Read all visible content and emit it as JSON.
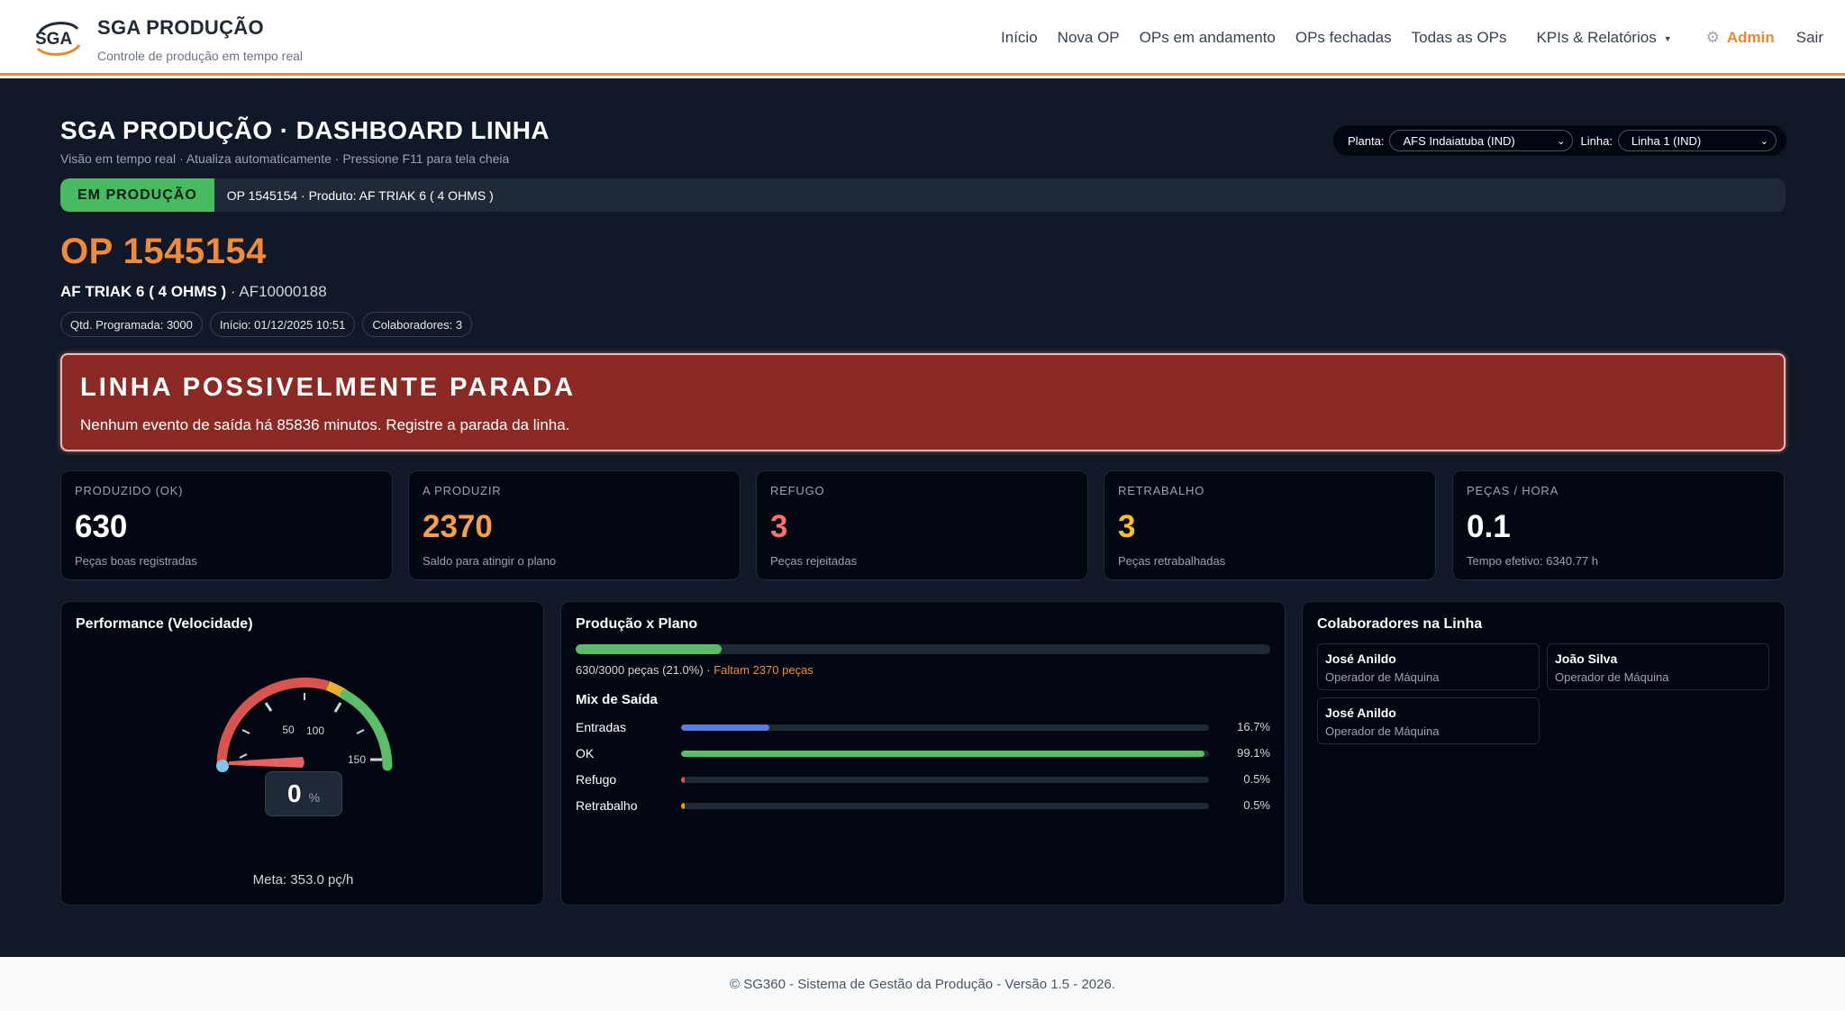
{
  "brand": {
    "logo_text": "SGA",
    "title": "SGA PRODUÇÃO",
    "subtitle": "Controle de produção em tempo real"
  },
  "nav": {
    "links": [
      "Início",
      "Nova OP",
      "OPs em andamento",
      "OPs fechadas",
      "Todas as OPs"
    ],
    "dropdown_label": "KPIs & Relatórios",
    "user_label": "Admin",
    "logout_label": "Sair"
  },
  "dashboard": {
    "title": "SGA PRODUÇÃO · DASHBOARD LINHA",
    "subtitle": "Visão em tempo real · Atualiza automaticamente · Pressione F11 para tela cheia",
    "planta_label": "Planta:",
    "planta_value": "AFS Indaiatuba (IND)",
    "linha_label": "Linha:",
    "linha_value": "Linha 1 (IND)"
  },
  "status": {
    "badge": "EM PRODUÇÃO",
    "text": "OP 1545154 · Produto: AF TRIAK 6 ( 4 OHMS )",
    "badge_color": "#48bb62"
  },
  "op": {
    "title": "OP 1545154",
    "product": "AF TRIAK 6 ( 4 OHMS )",
    "code": "· AF10000188",
    "pills": [
      "Qtd. Programada: 3000",
      "Início: 01/12/2025 10:51",
      "Colaboradores: 3"
    ]
  },
  "alert": {
    "title": "LINHA POSSIVELMENTE PARADA",
    "message": "Nenhum evento de saída há 85836 minutos. Registre a parada da linha.",
    "color": "#8b2a25"
  },
  "kpis": [
    {
      "label": "PRODUZIDO (OK)",
      "value": "630",
      "sub": "Peças boas registradas",
      "color": "#ffffff"
    },
    {
      "label": "A PRODUZIR",
      "value": "2370",
      "sub": "Saldo para atingir o plano",
      "color": "#f6a04d"
    },
    {
      "label": "REFUGO",
      "value": "3",
      "sub": "Peças rejeitadas",
      "color": "#f87171"
    },
    {
      "label": "RETRABALHO",
      "value": "3",
      "sub": "Peças retrabalhadas",
      "color": "#fbbf24"
    },
    {
      "label": "PEÇAS / HORA",
      "value": "0.1",
      "sub": "Tempo efetivo: 6340.77 h",
      "color": "#ffffff"
    }
  ],
  "performance": {
    "title": "Performance (Velocidade)",
    "value": "0",
    "unit": "%",
    "percent": 0,
    "tick_labels": [
      "50",
      "100",
      "150"
    ],
    "meta": "Meta: 353.0 pç/h"
  },
  "producao": {
    "title": "Produção x Plano",
    "progress_fraction": 0.21,
    "progress_text": "630/3000 peças (21.0%) ·",
    "faltam_text": "Faltam 2370 peças",
    "mix_title": "Mix de Saída",
    "mix": [
      {
        "label": "Entradas",
        "pct_text": "16.7%",
        "fraction": 0.167,
        "color": "#5b7be0"
      },
      {
        "label": "OK",
        "pct_text": "99.1%",
        "fraction": 0.991,
        "color": "#5bbd69"
      },
      {
        "label": "Refugo",
        "pct_text": "0.5%",
        "fraction": 0.005,
        "color": "#e05252"
      },
      {
        "label": "Retrabalho",
        "pct_text": "0.5%",
        "fraction": 0.005,
        "color": "#e0a030"
      }
    ]
  },
  "colaboradores": {
    "title": "Colaboradores na Linha",
    "items": [
      {
        "name": "José Anildo",
        "role": "Operador de Máquina"
      },
      {
        "name": "João Silva",
        "role": "Operador de Máquina"
      },
      {
        "name": "José Anildo",
        "role": "Operador de Máquina"
      }
    ]
  },
  "footer": {
    "text": "© SG360 - Sistema de Gestão da Produção - Versão 1.5 - 2026."
  }
}
